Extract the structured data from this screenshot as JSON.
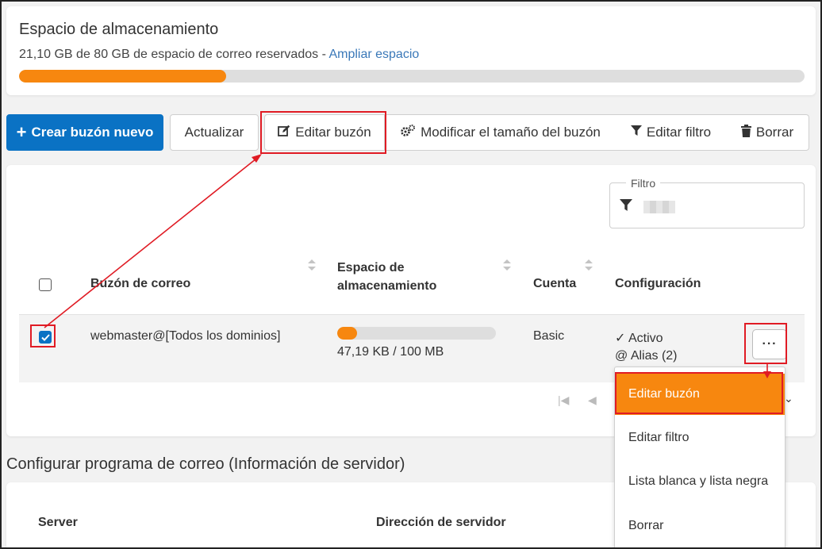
{
  "storage": {
    "title": "Espacio de almacenamiento",
    "usage_text": "21,10 GB de 80 GB de espacio de correo reservados - ",
    "expand_link": "Ampliar espacio",
    "used_fraction": 0.264,
    "accent_color": "#f7870f"
  },
  "toolbar": {
    "create_label": "Crear buzón nuevo",
    "refresh_label": "Actualizar",
    "edit_label": "Editar buzón",
    "resize_label": "Modificar el tamaño del buzón",
    "filter_label": "Editar filtro",
    "delete_label": "Borrar",
    "primary_color": "#0a72c4"
  },
  "filter": {
    "label": "Filtro"
  },
  "table": {
    "headers": {
      "mailbox": "Buzón de correo",
      "storage_line1": "Espacio de",
      "storage_line2": "almacenamiento",
      "account": "Cuenta",
      "config": "Configuración"
    },
    "rows": [
      {
        "mailbox": "webmaster@[Todos los dominios]",
        "storage_text": "47,19 KB / 100 MB",
        "storage_fraction": 0.125,
        "account": "Basic",
        "status": "Activo",
        "alias": "Alias (2)",
        "checked": true
      }
    ],
    "more_label": "···"
  },
  "dropdown": {
    "items": [
      "Editar buzón",
      "Editar filtro",
      "Lista blanca y lista negra",
      "Borrar"
    ]
  },
  "server_section": {
    "title": "Configurar programa de correo (Información de servidor)",
    "col_server": "Server",
    "col_address": "Dirección de servidor"
  }
}
